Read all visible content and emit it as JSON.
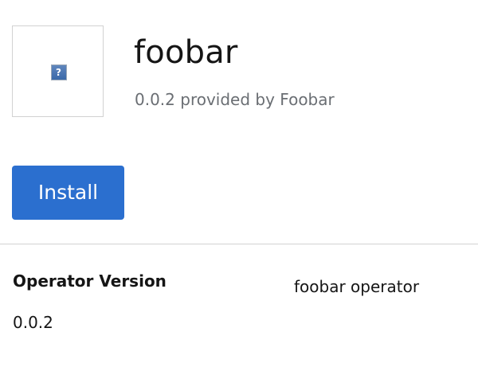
{
  "header": {
    "logo_icon": "broken-image-icon",
    "logo_placeholder_glyph": "?",
    "title": "foobar",
    "subtitle": "0.0.2 provided by Foobar"
  },
  "actions": {
    "install_label": "Install",
    "install_color": "#2b6fcf"
  },
  "details": {
    "operator_version_label": "Operator Version",
    "operator_version_value": "0.0.2",
    "description": "foobar operator"
  }
}
